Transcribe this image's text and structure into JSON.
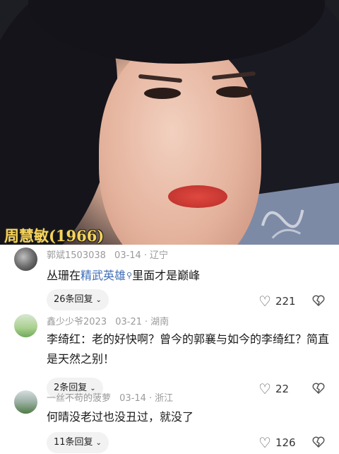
{
  "photo": {
    "caption": "周慧敏(1966)"
  },
  "comments": [
    {
      "username": "郭斌1503038",
      "date": "03-14",
      "location": "辽宁",
      "text_before": "丛珊在",
      "link_text": "精武英雄",
      "text_after": "里面才是巅峰",
      "replies": "26条回复",
      "likes": "221"
    },
    {
      "username": "鑫少少爷2023",
      "date": "03-21",
      "location": "湖南",
      "text": "李绮红：老的好快啊？曾今的郭襄与如今的李绮红？简直是天然之别！",
      "replies": "2条回复",
      "likes": "22"
    },
    {
      "username": "一丝不苟的菠萝",
      "date": "03-14",
      "location": "浙江",
      "text": "何晴没老过也没丑过，就没了",
      "replies": "11条回复",
      "likes": "126"
    }
  ]
}
